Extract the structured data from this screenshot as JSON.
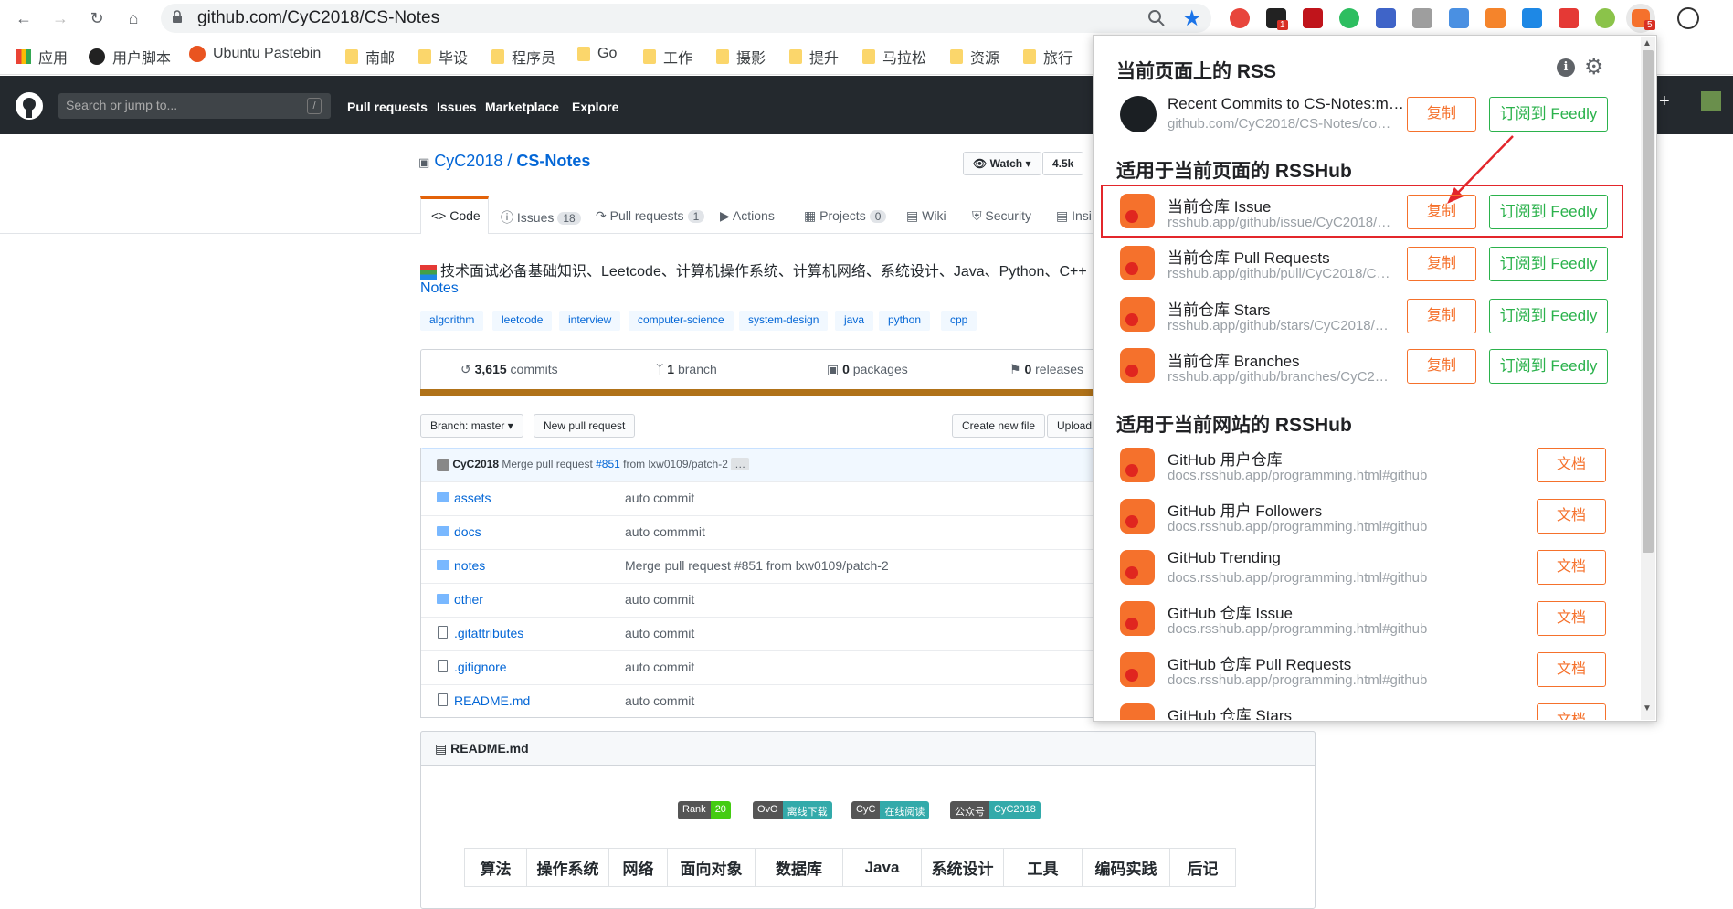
{
  "browser": {
    "url": "github.com/CyC2018/CS-Notes",
    "ext_badge_1": "1",
    "ext_badge_5": "5"
  },
  "bookmarks": [
    {
      "label": "应用"
    },
    {
      "label": "用户脚本"
    },
    {
      "label": "Ubuntu Pastebin"
    },
    {
      "label": "南邮"
    },
    {
      "label": "毕设"
    },
    {
      "label": "程序员"
    },
    {
      "label": "Go"
    },
    {
      "label": "工作"
    },
    {
      "label": "摄影"
    },
    {
      "label": "提升"
    },
    {
      "label": "马拉松"
    },
    {
      "label": "资源"
    },
    {
      "label": "旅行"
    }
  ],
  "github": {
    "search_placeholder": "Search or jump to...",
    "slash": "/",
    "nav": [
      "Pull requests",
      "Issues",
      "Marketplace",
      "Explore"
    ],
    "owner": "CyC2018",
    "sep": " / ",
    "repo": "CS-Notes",
    "watch_label": "Watch",
    "watch_count": "4.5k",
    "tabs": [
      {
        "label": "Code",
        "count": ""
      },
      {
        "label": "Issues",
        "count": "18"
      },
      {
        "label": "Pull requests",
        "count": "1"
      },
      {
        "label": "Actions",
        "count": ""
      },
      {
        "label": "Projects",
        "count": "0"
      },
      {
        "label": "Wiki",
        "count": ""
      },
      {
        "label": "Security",
        "count": ""
      },
      {
        "label": "Insi",
        "count": ""
      }
    ],
    "description": "技术面试必备基础知识、Leetcode、计算机操作系统、计算机网络、系统设计、Java、Python、C++",
    "description_link": "Notes",
    "topics": [
      "algorithm",
      "leetcode",
      "interview",
      "computer-science",
      "system-design",
      "java",
      "python",
      "cpp"
    ],
    "stats": {
      "commits_num": "3,615",
      "commits_label": " commits",
      "branch_num": "1",
      "branch_label": " branch",
      "packages_num": "0",
      "packages_label": " packages",
      "releases_num": "0",
      "releases_label": " releases"
    },
    "branch_btn": "Branch: master",
    "new_pr_btn": "New pull request",
    "create_file_btn": "Create new file",
    "upload_btn": "Upload",
    "commit_author": "CyC2018",
    "commit_msg": "Merge pull request",
    "commit_pr": "#851",
    "commit_from": "from lxw0109/patch-2",
    "commit_ellipsis": "…",
    "files": [
      {
        "name": "assets",
        "msg": "auto commit",
        "type": "dir"
      },
      {
        "name": "docs",
        "msg": "auto commmit",
        "type": "dir"
      },
      {
        "name": "notes",
        "msg": "Merge pull request #851 from lxw0109/patch-2",
        "type": "dir"
      },
      {
        "name": "other",
        "msg": "auto commit",
        "type": "dir"
      },
      {
        "name": ".gitattributes",
        "msg": "auto commit",
        "type": "file"
      },
      {
        "name": ".gitignore",
        "msg": "auto commit",
        "type": "file"
      },
      {
        "name": "README.md",
        "msg": "auto commit",
        "type": "file"
      }
    ],
    "readme_title": "README.md",
    "badges": [
      {
        "left": "Rank",
        "right": "20",
        "color": "#4c1"
      },
      {
        "left": "OvO",
        "right": "离线下载",
        "color": "#3aa"
      },
      {
        "left": "CyC",
        "right": "在线阅读",
        "color": "#3aa"
      },
      {
        "left": "公众号",
        "right": "CyC2018",
        "color": "#3aa"
      }
    ],
    "toc": [
      "算法",
      "操作系统",
      "网络",
      "面向对象",
      "数据库",
      "Java",
      "系统设计",
      "工具",
      "编码实践",
      "后记"
    ]
  },
  "popup": {
    "section1": "当前页面上的 RSS",
    "section2": "适用于当前页面的 RSSHub",
    "section3": "适用于当前网站的 RSSHub",
    "copy_label": "复制",
    "feedly_label": "订阅到 Feedly",
    "doc_label": "文档",
    "page_rss": [
      {
        "title": "Recent Commits to CS-Notes:m…",
        "sub": "github.com/CyC2018/CS-Notes/co…"
      }
    ],
    "page_rsshub": [
      {
        "title": "当前仓库 Issue",
        "sub": "rsshub.app/github/issue/CyC2018/…"
      },
      {
        "title": "当前仓库 Pull Requests",
        "sub": "rsshub.app/github/pull/CyC2018/C…"
      },
      {
        "title": "当前仓库 Stars",
        "sub": "rsshub.app/github/stars/CyC2018/…"
      },
      {
        "title": "当前仓库 Branches",
        "sub": "rsshub.app/github/branches/CyC2…"
      }
    ],
    "site_rsshub": [
      {
        "title": "GitHub 用户仓库",
        "sub": "docs.rsshub.app/programming.html#github"
      },
      {
        "title": "GitHub 用户 Followers",
        "sub": "docs.rsshub.app/programming.html#github"
      },
      {
        "title": "GitHub Trending",
        "sub": "docs.rsshub.app/programming.html#github"
      },
      {
        "title": "GitHub 仓库 Issue",
        "sub": "docs.rsshub.app/programming.html#github"
      },
      {
        "title": "GitHub 仓库 Pull Requests",
        "sub": "docs.rsshub.app/programming.html#github"
      },
      {
        "title": "GitHub 仓库 Stars",
        "sub": ""
      }
    ]
  }
}
